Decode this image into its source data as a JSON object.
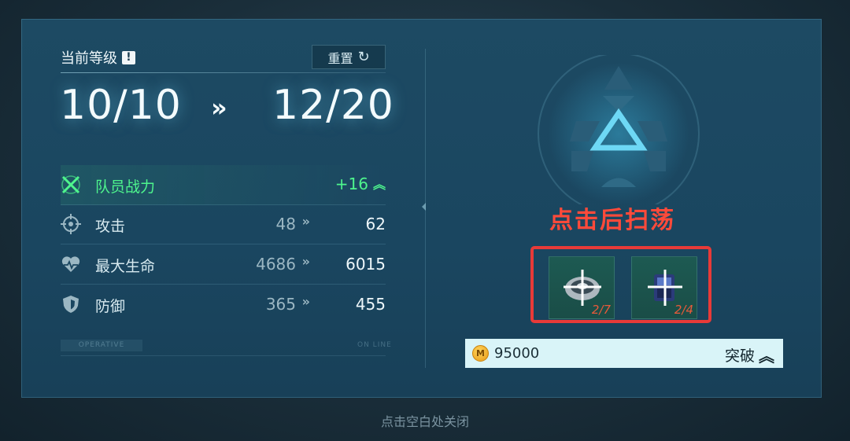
{
  "level": {
    "title": "当前等级",
    "warn_icon": "!",
    "reset_label": "重置",
    "reset_icon": "↻",
    "from": "10/10",
    "arrow": "»",
    "to": "12/20"
  },
  "stats": {
    "power": {
      "label": "队员战力",
      "delta": "+16",
      "up": "︽",
      "icon": "crossed-swords-icon"
    },
    "rows": [
      {
        "label": "攻击",
        "old": "48",
        "arrow": "»",
        "new": "62",
        "icon": "crosshair-icon"
      },
      {
        "label": "最大生命",
        "old": "4686",
        "arrow": "»",
        "new": "6015",
        "icon": "heart-icon"
      },
      {
        "label": "防御",
        "old": "365",
        "arrow": "»",
        "new": "455",
        "icon": "shield-icon"
      }
    ]
  },
  "watermark": {
    "operative": "OPERATIVE",
    "online": "ON LINE"
  },
  "sweep_hint": "点击后扫荡",
  "items": [
    {
      "count": "2/7",
      "icon": "ring-material-icon"
    },
    {
      "count": "2/4",
      "icon": "chip-material-icon"
    }
  ],
  "breakthrough": {
    "coin_icon": "coin-icon",
    "coin_mark": "M",
    "amount": "95000",
    "label": "突破",
    "arrow": "︽"
  },
  "close_hint": "点击空白处关闭",
  "colors": {
    "panel": "#1d4a63",
    "power_green": "#4ef58d",
    "highlight_red": "#e83a38",
    "button_bg": "#d9f4f8"
  }
}
